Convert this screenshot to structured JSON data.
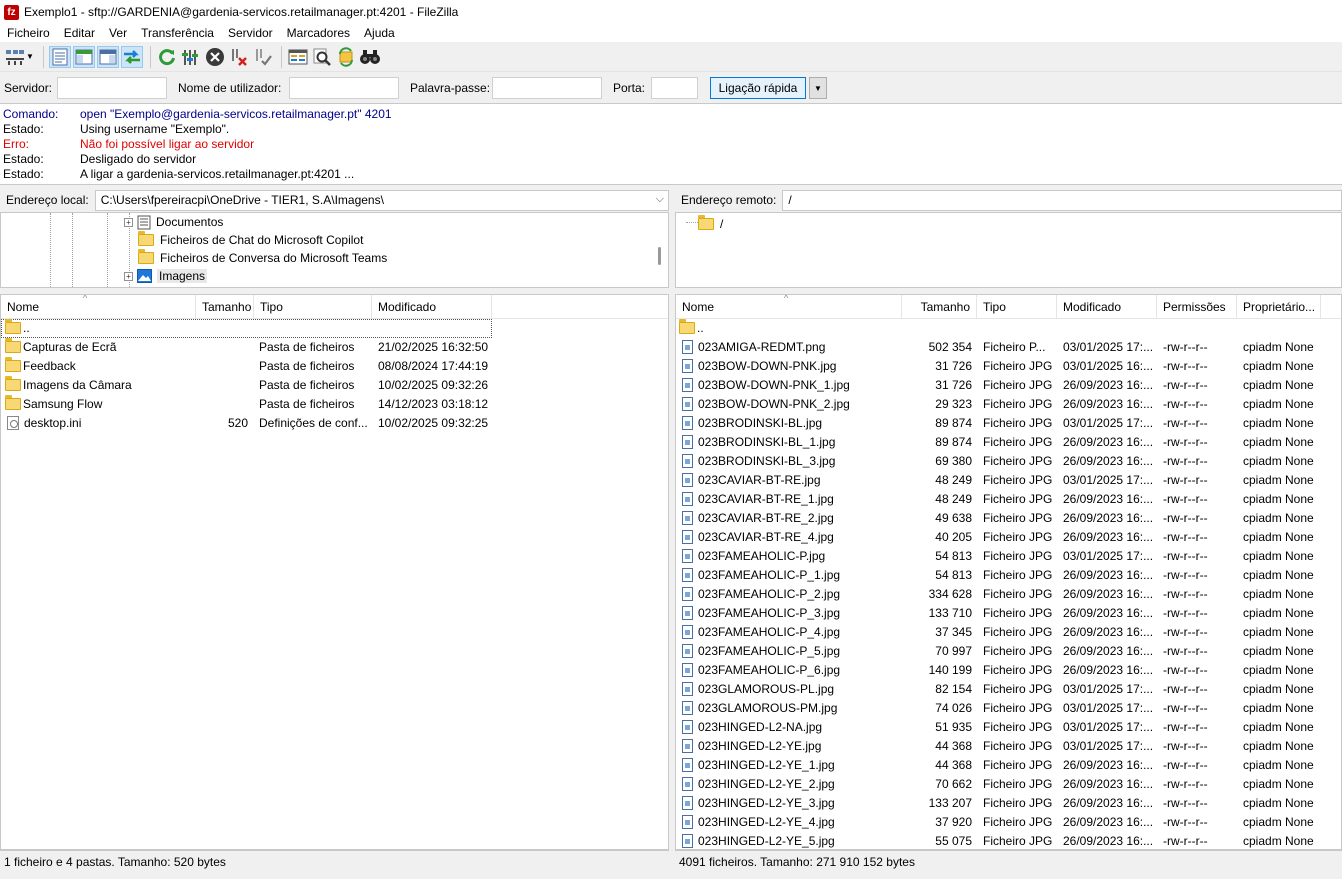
{
  "window": {
    "title": "Exemplo1 - sftp://GARDENIA@gardenia-servicos.retailmanager.pt:4201 - FileZilla",
    "app_icon": "fz"
  },
  "menu": [
    "Ficheiro",
    "Editar",
    "Ver",
    "Transferência",
    "Servidor",
    "Marcadores",
    "Ajuda"
  ],
  "quickconnect": {
    "host_label": "Servidor:",
    "host_value": "",
    "user_label": "Nome de utilizador:",
    "user_value": "",
    "pass_label": "Palavra-passe:",
    "pass_value": "",
    "port_label": "Porta:",
    "port_value": "",
    "connect_label": "Ligação rápida"
  },
  "log": [
    {
      "kind": "cmd",
      "label": "Comando:",
      "text": "open \"Exemplo@gardenia-servicos.retailmanager.pt\" 4201"
    },
    {
      "kind": "status",
      "label": "Estado:",
      "text": "Using username \"Exemplo\"."
    },
    {
      "kind": "err",
      "label": "Erro:",
      "text": "Não foi possível ligar ao servidor"
    },
    {
      "kind": "status",
      "label": "Estado:",
      "text": "Desligado do servidor"
    },
    {
      "kind": "status",
      "label": "Estado:",
      "text": "A ligar a gardenia-servicos.retailmanager.pt:4201 ..."
    }
  ],
  "local": {
    "address_label": "Endereço local:",
    "address": "C:\\Users\\fpereiracpi\\OneDrive - TIER1, S.A\\Imagens\\",
    "tree": [
      {
        "label": "Documentos",
        "icon": "documents-icon",
        "expander": "+"
      },
      {
        "label": "Ficheiros de Chat do Microsoft Copilot",
        "icon": "folder-icon",
        "expander": ""
      },
      {
        "label": "Ficheiros de Conversa do Microsoft Teams",
        "icon": "folder-icon",
        "expander": ""
      },
      {
        "label": "Imagens",
        "icon": "pictures-icon",
        "expander": "+"
      }
    ],
    "columns": [
      "Nome",
      "Tamanho",
      "Tipo",
      "Modificado"
    ],
    "files": [
      {
        "name": "..",
        "size": "",
        "type": "",
        "modified": "",
        "icon": "folder"
      },
      {
        "name": "Capturas de Ecrã",
        "size": "",
        "type": "Pasta de ficheiros",
        "modified": "21/02/2025 16:32:50",
        "icon": "folder"
      },
      {
        "name": "Feedback",
        "size": "",
        "type": "Pasta de ficheiros",
        "modified": "08/08/2024 17:44:19",
        "icon": "folder"
      },
      {
        "name": "Imagens da Câmara",
        "size": "",
        "type": "Pasta de ficheiros",
        "modified": "10/02/2025 09:32:26",
        "icon": "folder"
      },
      {
        "name": "Samsung Flow",
        "size": "",
        "type": "Pasta de ficheiros",
        "modified": "14/12/2023 03:18:12",
        "icon": "folder"
      },
      {
        "name": "desktop.ini",
        "size": "520",
        "type": "Definições de conf...",
        "modified": "10/02/2025 09:32:25",
        "icon": "ini"
      }
    ],
    "status": "1 ficheiro e 4 pastas. Tamanho: 520 bytes"
  },
  "remote": {
    "address_label": "Endereço remoto:",
    "address": "/",
    "tree_root": "/",
    "columns": [
      "Nome",
      "Tamanho",
      "Tipo",
      "Modificado",
      "Permissões",
      "Proprietário..."
    ],
    "files": [
      {
        "name": "..",
        "size": "",
        "type": "",
        "modified": "",
        "perm": "",
        "owner": "",
        "icon": "folder"
      },
      {
        "name": "023AMIGA-REDMT.png",
        "size": "502 354",
        "type": "Ficheiro P...",
        "modified": "03/01/2025 17:...",
        "perm": "-rw-r--r--",
        "owner": "cpiadm None",
        "icon": "file"
      },
      {
        "name": "023BOW-DOWN-PNK.jpg",
        "size": "31 726",
        "type": "Ficheiro JPG",
        "modified": "03/01/2025 16:...",
        "perm": "-rw-r--r--",
        "owner": "cpiadm None",
        "icon": "file"
      },
      {
        "name": "023BOW-DOWN-PNK_1.jpg",
        "size": "31 726",
        "type": "Ficheiro JPG",
        "modified": "26/09/2023 16:...",
        "perm": "-rw-r--r--",
        "owner": "cpiadm None",
        "icon": "file"
      },
      {
        "name": "023BOW-DOWN-PNK_2.jpg",
        "size": "29 323",
        "type": "Ficheiro JPG",
        "modified": "26/09/2023 16:...",
        "perm": "-rw-r--r--",
        "owner": "cpiadm None",
        "icon": "file"
      },
      {
        "name": "023BRODINSKI-BL.jpg",
        "size": "89 874",
        "type": "Ficheiro JPG",
        "modified": "03/01/2025 17:...",
        "perm": "-rw-r--r--",
        "owner": "cpiadm None",
        "icon": "file"
      },
      {
        "name": "023BRODINSKI-BL_1.jpg",
        "size": "89 874",
        "type": "Ficheiro JPG",
        "modified": "26/09/2023 16:...",
        "perm": "-rw-r--r--",
        "owner": "cpiadm None",
        "icon": "file"
      },
      {
        "name": "023BRODINSKI-BL_3.jpg",
        "size": "69 380",
        "type": "Ficheiro JPG",
        "modified": "26/09/2023 16:...",
        "perm": "-rw-r--r--",
        "owner": "cpiadm None",
        "icon": "file"
      },
      {
        "name": "023CAVIAR-BT-RE.jpg",
        "size": "48 249",
        "type": "Ficheiro JPG",
        "modified": "03/01/2025 17:...",
        "perm": "-rw-r--r--",
        "owner": "cpiadm None",
        "icon": "file"
      },
      {
        "name": "023CAVIAR-BT-RE_1.jpg",
        "size": "48 249",
        "type": "Ficheiro JPG",
        "modified": "26/09/2023 16:...",
        "perm": "-rw-r--r--",
        "owner": "cpiadm None",
        "icon": "file"
      },
      {
        "name": "023CAVIAR-BT-RE_2.jpg",
        "size": "49 638",
        "type": "Ficheiro JPG",
        "modified": "26/09/2023 16:...",
        "perm": "-rw-r--r--",
        "owner": "cpiadm None",
        "icon": "file"
      },
      {
        "name": "023CAVIAR-BT-RE_4.jpg",
        "size": "40 205",
        "type": "Ficheiro JPG",
        "modified": "26/09/2023 16:...",
        "perm": "-rw-r--r--",
        "owner": "cpiadm None",
        "icon": "file"
      },
      {
        "name": "023FAMEAHOLIC-P.jpg",
        "size": "54 813",
        "type": "Ficheiro JPG",
        "modified": "03/01/2025 17:...",
        "perm": "-rw-r--r--",
        "owner": "cpiadm None",
        "icon": "file"
      },
      {
        "name": "023FAMEAHOLIC-P_1.jpg",
        "size": "54 813",
        "type": "Ficheiro JPG",
        "modified": "26/09/2023 16:...",
        "perm": "-rw-r--r--",
        "owner": "cpiadm None",
        "icon": "file"
      },
      {
        "name": "023FAMEAHOLIC-P_2.jpg",
        "size": "334 628",
        "type": "Ficheiro JPG",
        "modified": "26/09/2023 16:...",
        "perm": "-rw-r--r--",
        "owner": "cpiadm None",
        "icon": "file"
      },
      {
        "name": "023FAMEAHOLIC-P_3.jpg",
        "size": "133 710",
        "type": "Ficheiro JPG",
        "modified": "26/09/2023 16:...",
        "perm": "-rw-r--r--",
        "owner": "cpiadm None",
        "icon": "file"
      },
      {
        "name": "023FAMEAHOLIC-P_4.jpg",
        "size": "37 345",
        "type": "Ficheiro JPG",
        "modified": "26/09/2023 16:...",
        "perm": "-rw-r--r--",
        "owner": "cpiadm None",
        "icon": "file"
      },
      {
        "name": "023FAMEAHOLIC-P_5.jpg",
        "size": "70 997",
        "type": "Ficheiro JPG",
        "modified": "26/09/2023 16:...",
        "perm": "-rw-r--r--",
        "owner": "cpiadm None",
        "icon": "file"
      },
      {
        "name": "023FAMEAHOLIC-P_6.jpg",
        "size": "140 199",
        "type": "Ficheiro JPG",
        "modified": "26/09/2023 16:...",
        "perm": "-rw-r--r--",
        "owner": "cpiadm None",
        "icon": "file"
      },
      {
        "name": "023GLAMOROUS-PL.jpg",
        "size": "82 154",
        "type": "Ficheiro JPG",
        "modified": "03/01/2025 17:...",
        "perm": "-rw-r--r--",
        "owner": "cpiadm None",
        "icon": "file"
      },
      {
        "name": "023GLAMOROUS-PM.jpg",
        "size": "74 026",
        "type": "Ficheiro JPG",
        "modified": "03/01/2025 17:...",
        "perm": "-rw-r--r--",
        "owner": "cpiadm None",
        "icon": "file"
      },
      {
        "name": "023HINGED-L2-NA.jpg",
        "size": "51 935",
        "type": "Ficheiro JPG",
        "modified": "03/01/2025 17:...",
        "perm": "-rw-r--r--",
        "owner": "cpiadm None",
        "icon": "file"
      },
      {
        "name": "023HINGED-L2-YE.jpg",
        "size": "44 368",
        "type": "Ficheiro JPG",
        "modified": "03/01/2025 17:...",
        "perm": "-rw-r--r--",
        "owner": "cpiadm None",
        "icon": "file"
      },
      {
        "name": "023HINGED-L2-YE_1.jpg",
        "size": "44 368",
        "type": "Ficheiro JPG",
        "modified": "26/09/2023 16:...",
        "perm": "-rw-r--r--",
        "owner": "cpiadm None",
        "icon": "file"
      },
      {
        "name": "023HINGED-L2-YE_2.jpg",
        "size": "70 662",
        "type": "Ficheiro JPG",
        "modified": "26/09/2023 16:...",
        "perm": "-rw-r--r--",
        "owner": "cpiadm None",
        "icon": "file"
      },
      {
        "name": "023HINGED-L2-YE_3.jpg",
        "size": "133 207",
        "type": "Ficheiro JPG",
        "modified": "26/09/2023 16:...",
        "perm": "-rw-r--r--",
        "owner": "cpiadm None",
        "icon": "file"
      },
      {
        "name": "023HINGED-L2-YE_4.jpg",
        "size": "37 920",
        "type": "Ficheiro JPG",
        "modified": "26/09/2023 16:...",
        "perm": "-rw-r--r--",
        "owner": "cpiadm None",
        "icon": "file"
      },
      {
        "name": "023HINGED-L2-YE_5.jpg",
        "size": "55 075",
        "type": "Ficheiro JPG",
        "modified": "26/09/2023 16:...",
        "perm": "-rw-r--r--",
        "owner": "cpiadm None",
        "icon": "file"
      }
    ],
    "status": "4091 ficheiros. Tamanho: 271 910 152 bytes"
  }
}
